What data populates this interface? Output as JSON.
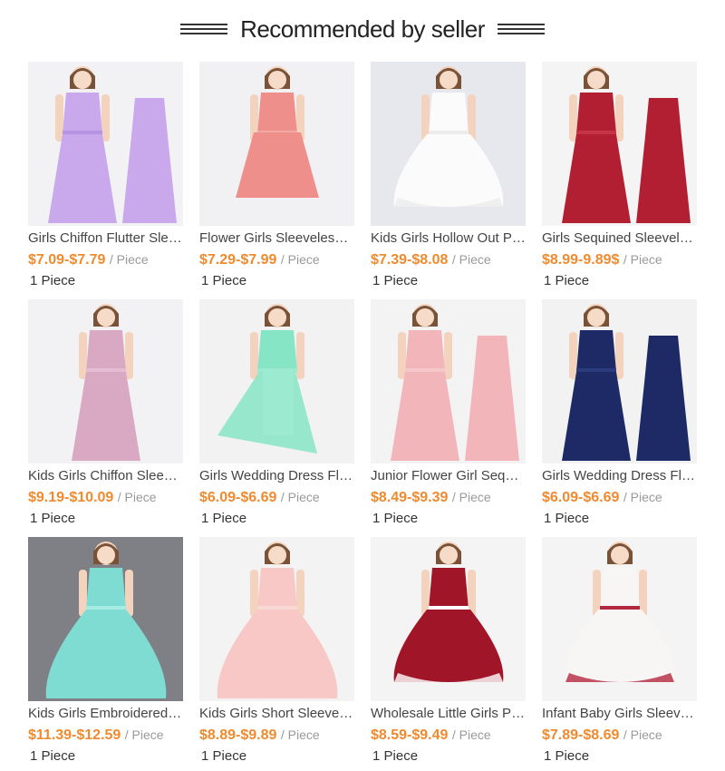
{
  "header": {
    "title": "Recommended by seller"
  },
  "products": [
    {
      "title": "Girls Chiffon Flutter Sleeve Maxi Dress",
      "price": "$7.09-$7.79",
      "unit": "/ Piece",
      "moq": "1 Piece",
      "bg": "#f2f2f4",
      "dress": "#c9a8ec",
      "accent": "#b794e2",
      "style": "double-long"
    },
    {
      "title": "Flower Girls Sleeveless Lace Dress",
      "price": "$7.29-$7.99",
      "unit": "/ Piece",
      "moq": "1 Piece",
      "bg": "#f1f1f3",
      "dress": "#ef8f8c",
      "accent": "#f3a8a4",
      "style": "knee"
    },
    {
      "title": "Kids Girls Hollow Out Princess Dress",
      "price": "$7.39-$8.08",
      "unit": "/ Piece",
      "moq": "1 Piece",
      "bg": "#e7e8ee",
      "dress": "#fbfbfb",
      "accent": "#ececec",
      "style": "puff"
    },
    {
      "title": "Girls Sequined Sleeveless Lace Dress",
      "price": "$8.99-9.89$",
      "unit": "/ Piece",
      "moq": "1 Piece",
      "bg": "#f4f4f4",
      "dress": "#b21f32",
      "accent": "#c73347",
      "style": "double-long"
    },
    {
      "title": "Kids Girls Chiffon Sleeveless Dress",
      "price": "$9.19-$10.09",
      "unit": "/ Piece",
      "moq": "1 Piece",
      "bg": "#f2f2f4",
      "dress": "#d9a9c4",
      "accent": "#e4bbd2",
      "style": "long"
    },
    {
      "title": "Girls Wedding Dress Flower Romper",
      "price": "$6.09-$6.69",
      "unit": "/ Piece",
      "moq": "1 Piece",
      "bg": "#f2f2f2",
      "dress": "#86e5c4",
      "accent": "#9cebd0",
      "style": "hilo"
    },
    {
      "title": "Junior Flower Girl Sequin Dress",
      "price": "$8.49-$9.39",
      "unit": "/ Piece",
      "moq": "1 Piece",
      "bg": "#f3f3f3",
      "dress": "#f2b5ba",
      "accent": "#f6c7ca",
      "style": "double-long"
    },
    {
      "title": "Girls Wedding Dress Flower Romper",
      "price": "$6.09-$6.69",
      "unit": "/ Piece",
      "moq": "1 Piece",
      "bg": "#f2f2f2",
      "dress": "#1e2a66",
      "accent": "#2c3a7e",
      "style": "double-long"
    },
    {
      "title": "Kids Girls Embroidered Tulle Dress",
      "price": "$11.39-$12.59",
      "unit": "/ Piece",
      "moq": "1 Piece",
      "bg": "#7f7f86",
      "dress": "#7fdcd2",
      "accent": "#a5ece4",
      "style": "ball"
    },
    {
      "title": "Kids Girls Short Sleeve Satin Dress",
      "price": "$8.89-$9.89",
      "unit": "/ Piece",
      "moq": "1 Piece",
      "bg": "#f3f3f3",
      "dress": "#f7c8c6",
      "accent": "#f9d7d5",
      "style": "ball"
    },
    {
      "title": "Wholesale Little Girls Party Dress",
      "price": "$8.59-$9.49",
      "unit": "/ Piece",
      "moq": "1 Piece",
      "bg": "#f4f4f4",
      "dress": "#a01528",
      "accent": "#ffffff",
      "style": "puff"
    },
    {
      "title": "Infant Baby Girls Sleeveless Dress",
      "price": "$7.89-$8.69",
      "unit": "/ Piece",
      "moq": "1 Piece",
      "bg": "#f4f4f4",
      "dress": "#f8f5f5",
      "accent": "#b3283f",
      "style": "puff"
    }
  ]
}
